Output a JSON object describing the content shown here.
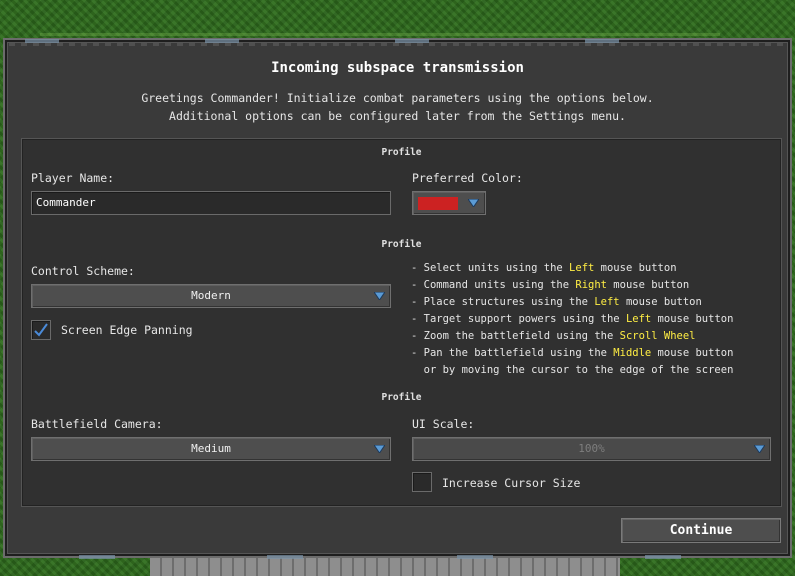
{
  "dialog": {
    "title": "Incoming subspace transmission",
    "intro_line1": "Greetings Commander! Initialize combat parameters using the options below.",
    "intro_line2": "Additional options can be configured later from the Settings menu."
  },
  "sections": {
    "profile1": "Profile",
    "profile2": "Profile",
    "profile3": "Profile"
  },
  "player": {
    "name_label": "Player Name:",
    "name_value": "Commander",
    "color_label": "Preferred Color:",
    "color_value": "#cc2222"
  },
  "controls": {
    "scheme_label": "Control Scheme:",
    "scheme_value": "Modern",
    "edge_panning_label": "Screen Edge Panning",
    "edge_panning_checked": true
  },
  "hints": [
    {
      "pre": "- Select units using the ",
      "key": "Left",
      "post": " mouse button"
    },
    {
      "pre": "- Command units using the ",
      "key": "Right",
      "post": " mouse button"
    },
    {
      "pre": "- Place structures using the ",
      "key": "Left",
      "post": " mouse button"
    },
    {
      "pre": "- Target support powers using the ",
      "key": "Left",
      "post": " mouse button"
    },
    {
      "pre": "- Zoom the battlefield using the ",
      "key": "Scroll Wheel",
      "post": ""
    },
    {
      "pre": "- Pan the battlefield using the ",
      "key": "Middle",
      "post": " mouse button"
    },
    {
      "pre": "  or by moving the cursor to the edge of the screen",
      "key": "",
      "post": ""
    }
  ],
  "display": {
    "camera_label": "Battlefield Camera:",
    "camera_value": "Medium",
    "ui_scale_label": "UI Scale:",
    "ui_scale_value": "100%",
    "cursor_size_label": "Increase Cursor Size",
    "cursor_size_checked": false
  },
  "footer": {
    "continue_label": "Continue"
  },
  "colors": {
    "highlight": "#ffee44",
    "arrow": "#5b9bd5",
    "check": "#4a8ad8"
  }
}
